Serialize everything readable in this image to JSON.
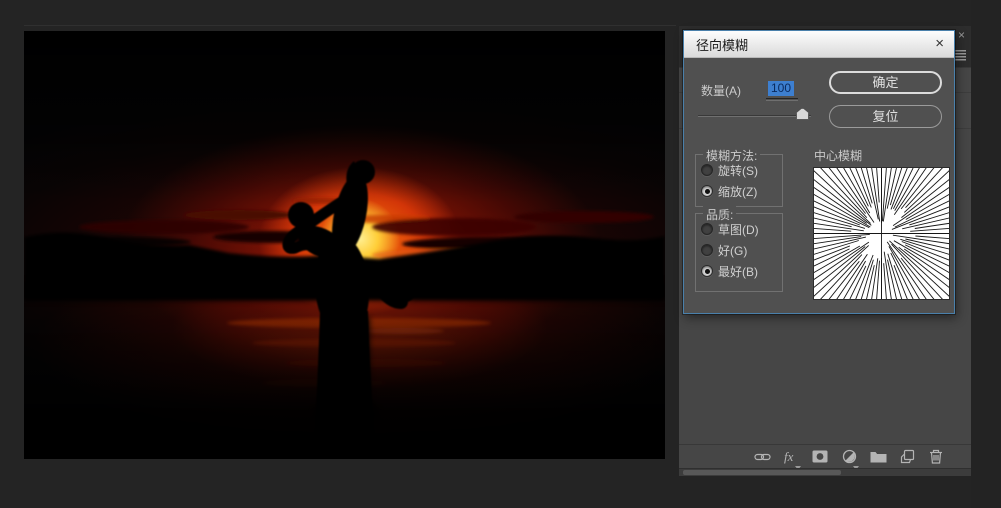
{
  "dialog": {
    "title": "径向模糊",
    "close_glyph": "×",
    "amount": {
      "label": "数量(A)",
      "value": "100"
    },
    "buttons": {
      "ok": "确定",
      "reset": "复位"
    },
    "method_group": {
      "label": "模糊方法:",
      "options": [
        {
          "label": "旋转(S)",
          "selected": false
        },
        {
          "label": "缩放(Z)",
          "selected": true
        }
      ]
    },
    "quality_group": {
      "label": "品质:",
      "options": [
        {
          "label": "草图(D)",
          "selected": false
        },
        {
          "label": "好(G)",
          "selected": false
        },
        {
          "label": "最好(B)",
          "selected": true
        }
      ]
    },
    "center_blur_label": "中心模糊"
  },
  "layers_panel": {
    "close_glyph": "×",
    "fx_label": "fx",
    "bottom_icons": [
      "link-icon",
      "fx-icon",
      "layer-mask-icon",
      "adjustment-layer-icon",
      "group-folder-icon",
      "new-layer-icon",
      "delete-layer-icon"
    ]
  },
  "colors": {
    "dialog_border": "#4a80ab",
    "selection_blue": "#3d7fd0",
    "dialog_body": "#505050",
    "panel_bg": "#464646",
    "workspace_bg": "#242424"
  }
}
